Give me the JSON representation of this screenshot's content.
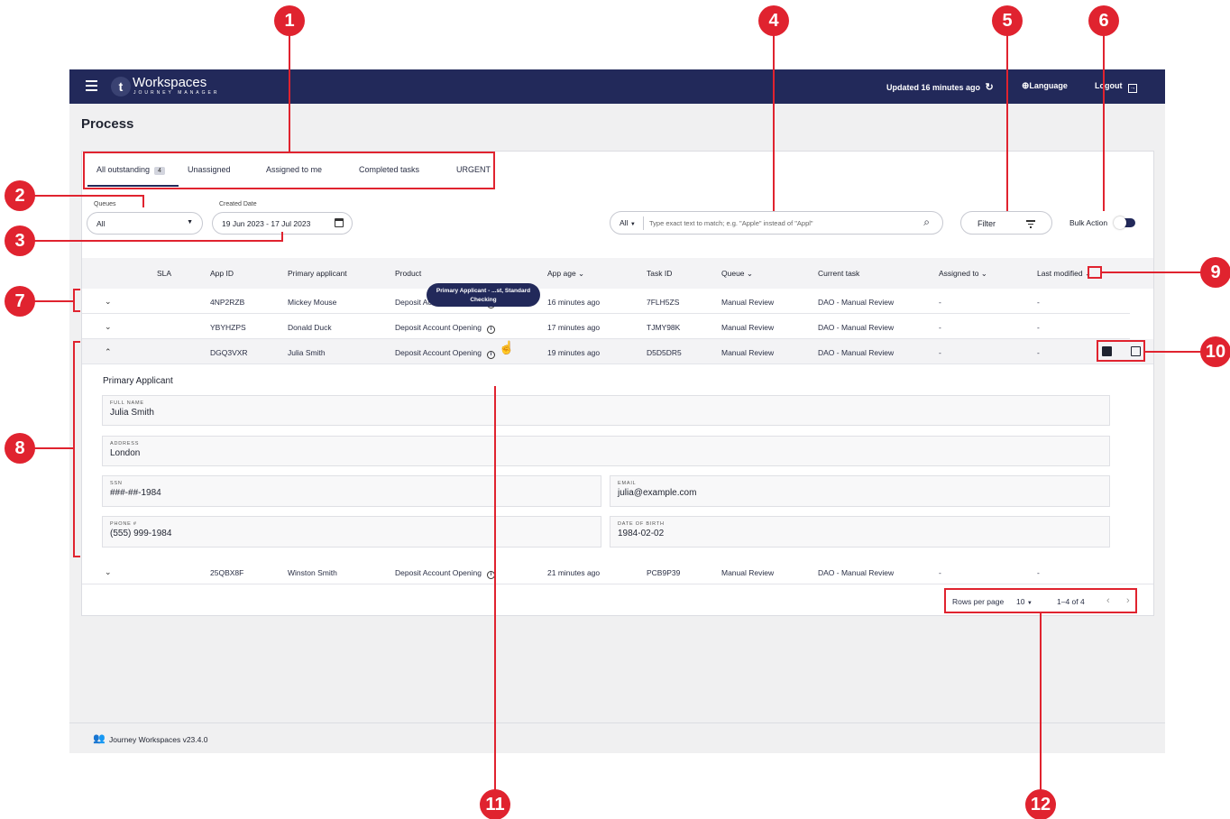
{
  "app": {
    "brand": "Workspaces",
    "brand_sub": "JOURNEY MANAGER",
    "updated_text": "Updated 16 minutes ago",
    "language_label": "Language",
    "logout_label": "Logout",
    "page_title": "Process",
    "footer_text": "Journey Workspaces v23.4.0"
  },
  "tabs": [
    {
      "label": "All outstanding",
      "badge": "4",
      "active": true
    },
    {
      "label": "Unassigned"
    },
    {
      "label": "Assigned to me"
    },
    {
      "label": "Completed tasks"
    },
    {
      "label": "URGENT"
    }
  ],
  "filters": {
    "queues_label": "Queues",
    "queues_value": "All",
    "date_label": "Created Date",
    "date_value": "19 Jun 2023 - 17 Jul 2023",
    "search_scope": "All",
    "search_placeholder": "Type exact text to match; e.g. \"Apple\" instead of \"Appl\"",
    "filter_label": "Filter",
    "bulk_action_label": "Bulk Action"
  },
  "table": {
    "headers": {
      "sla": "SLA",
      "app_id": "App ID",
      "primary_applicant": "Primary applicant",
      "product": "Product",
      "app_age": "App age",
      "task_id": "Task ID",
      "queue": "Queue",
      "current_task": "Current task",
      "assigned_to": "Assigned to",
      "last_modified": "Last modified"
    },
    "rows": [
      {
        "app_id": "4NP2RZB",
        "applicant": "Mickey Mouse",
        "product": "Deposit Account Opening",
        "age": "16 minutes ago",
        "task_id": "7FLH5ZS",
        "queue": "Manual Review",
        "current_task": "DAO - Manual Review",
        "assigned_to": "-",
        "last_modified": "-"
      },
      {
        "app_id": "YBYHZPS",
        "applicant": "Donald Duck",
        "product": "Deposit Account Opening",
        "age": "17 minutes ago",
        "task_id": "TJMY98K",
        "queue": "Manual Review",
        "current_task": "DAO - Manual Review",
        "assigned_to": "-",
        "last_modified": "-"
      },
      {
        "app_id": "DGQ3VXR",
        "applicant": "Julia Smith",
        "product": "Deposit Account Opening",
        "age": "19 minutes ago",
        "task_id": "D5D5DR5",
        "queue": "Manual Review",
        "current_task": "DAO - Manual Review",
        "assigned_to": "-",
        "last_modified": "-"
      },
      {
        "app_id": "25QBX8F",
        "applicant": "Winston Smith",
        "product": "Deposit Account Opening",
        "age": "21 minutes ago",
        "task_id": "PCB9P39",
        "queue": "Manual Review",
        "current_task": "DAO - Manual Review",
        "assigned_to": "-",
        "last_modified": "-"
      }
    ]
  },
  "expanded": {
    "section_title": "Primary Applicant",
    "full_name_label": "FULL NAME",
    "full_name": "Julia Smith",
    "address_label": "ADDRESS",
    "address": "London",
    "ssn_label": "SSN",
    "ssn": "###-##-1984",
    "email_label": "EMAIL",
    "email": "julia@example.com",
    "phone_label": "PHONE #",
    "phone": "(555) 999-1984",
    "dob_label": "DATE OF BIRTH",
    "dob": "1984-02-02"
  },
  "tooltip": {
    "line1": "Primary Applicant - ...st, Standard",
    "line2": "Checking"
  },
  "pagination": {
    "rows_per_page_label": "Rows per page",
    "rows_per_page": "10",
    "range": "1–4 of 4"
  },
  "callouts": [
    "1",
    "2",
    "3",
    "4",
    "5",
    "6",
    "7",
    "8",
    "9",
    "10",
    "11",
    "12"
  ],
  "colors": {
    "header_navy": "#22295a",
    "callout_red": "#e0232f",
    "background": "#f0f0f1"
  }
}
